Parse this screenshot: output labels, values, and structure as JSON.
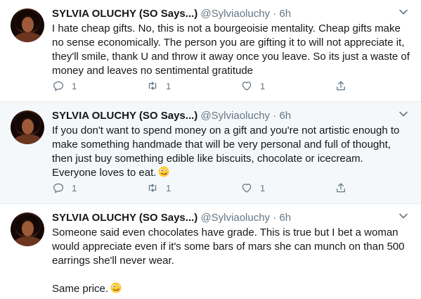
{
  "tweets": [
    {
      "name": "SYLVIA OLUCHY (SO Says...)",
      "handle": "@Sylviaoluchy",
      "dot": "·",
      "time": "6h",
      "paragraphs": [
        "I hate cheap gifts. No, this is not a bourgeoisie mentality. Cheap gifts make no sense economically. The person you are gifting it to will not appreciate it, they'll smile, thank U and throw it away once you leave. So its just a waste of money and leaves no sentimental gratitude"
      ],
      "reply_count": "1",
      "retweet_count": "1",
      "like_count": "1"
    },
    {
      "name": "SYLVIA OLUCHY (SO Says...)",
      "handle": "@Sylviaoluchy",
      "dot": "·",
      "time": "6h",
      "paragraphs": [
        "If you don't want to spend money on a gift and you're not artistic enough to make something handmade that will be very personal and full of thought, then just buy something edible like biscuits, chocolate or icecream. Everyone loves to eat."
      ],
      "emoji": "zany-face-emoji",
      "reply_count": "1",
      "retweet_count": "1",
      "like_count": "1"
    },
    {
      "name": "SYLVIA OLUCHY (SO Says...)",
      "handle": "@Sylviaoluchy",
      "dot": "·",
      "time": "6h",
      "paragraphs": [
        "Someone said even chocolates have grade. This is true but I bet a woman would appreciate even if it's some bars of mars she can munch on than 500 earrings she'll never wear.",
        "Same price."
      ],
      "emoji": "zany-face-emoji"
    }
  ],
  "icons": {
    "caret": "chevron-down-icon",
    "reply": "reply-icon",
    "retweet": "retweet-icon",
    "like": "heart-icon",
    "share": "share-icon"
  },
  "colors": {
    "name": "#14171a",
    "meta": "#657786",
    "highlight_bg": "#f5f8fa",
    "divider": "#e6ecf0"
  }
}
